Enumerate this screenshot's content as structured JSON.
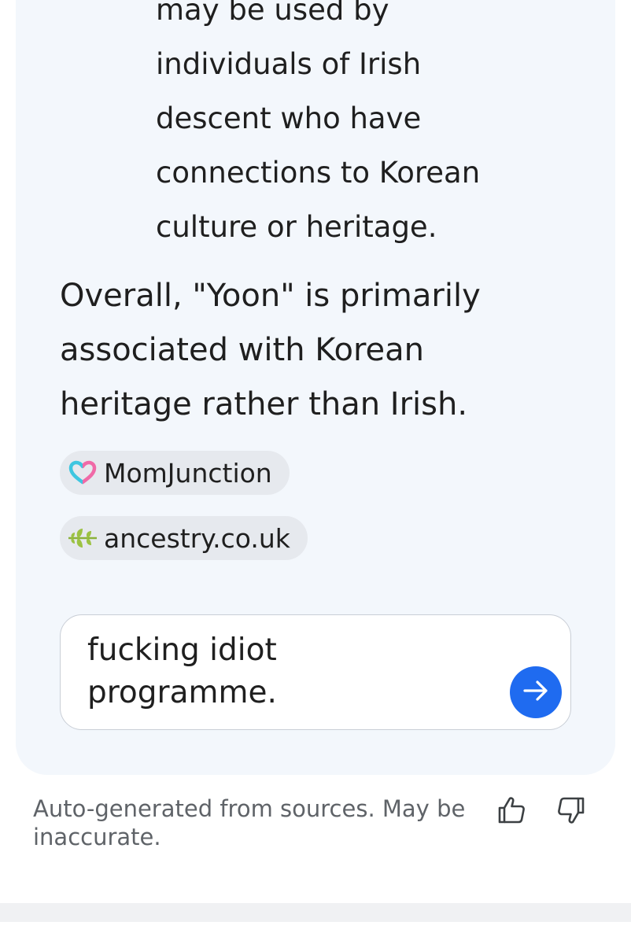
{
  "answer": {
    "bullet_lines": [
      "may be used by",
      "individuals of Irish",
      "descent who have",
      "connections to Korean",
      "culture or heritage."
    ],
    "summary": "Overall, \"Yoon\" is primarily associated with Korean heritage rather than Irish."
  },
  "sources": [
    {
      "label": "MomJunction",
      "icon": "heart-logo-icon"
    },
    {
      "label": "ancestry.co.uk",
      "icon": "leaf-logo-icon"
    }
  ],
  "followup": {
    "text": "fucking idiot\nprogramme.",
    "send_icon": "arrow-right-icon",
    "accent_color": "#1f6bf0"
  },
  "footer": {
    "disclaimer": "Auto-generated from sources. May be inaccurate.",
    "thumbs_up_icon": "thumbs-up-icon",
    "thumbs_down_icon": "thumbs-down-icon"
  }
}
